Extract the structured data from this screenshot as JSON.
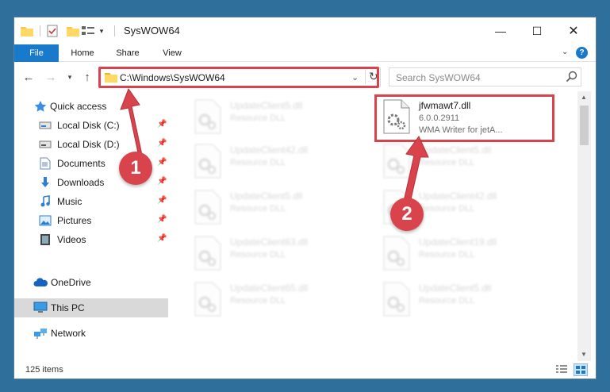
{
  "window": {
    "title": "SysWOW64",
    "min_glyph": "—",
    "max_glyph": "☐",
    "close_glyph": "✕"
  },
  "ribbon": {
    "tabs": [
      {
        "label": "File",
        "active": true
      },
      {
        "label": "Home"
      },
      {
        "label": "Share"
      },
      {
        "label": "View"
      }
    ],
    "help_label": "?"
  },
  "address": {
    "path": "C:\\Windows\\SysWOW64",
    "highlight_color": "#d9434c"
  },
  "search": {
    "placeholder": "Search SysWOW64"
  },
  "sidebar": {
    "items": [
      {
        "label": "Quick access",
        "icon": "star-icon",
        "pinned": false
      },
      {
        "label": "Local Disk (C:)",
        "icon": "drive-icon",
        "pinned": true
      },
      {
        "label": "Local Disk (D:)",
        "icon": "drive-icon",
        "pinned": true
      },
      {
        "label": "Documents",
        "icon": "documents-icon",
        "pinned": true
      },
      {
        "label": "Downloads",
        "icon": "downloads-icon",
        "pinned": true
      },
      {
        "label": "Music",
        "icon": "music-icon",
        "pinned": true
      },
      {
        "label": "Pictures",
        "icon": "pictures-icon",
        "pinned": true
      },
      {
        "label": "Videos",
        "icon": "videos-icon",
        "pinned": true
      },
      {
        "label": "OneDrive",
        "icon": "cloud-icon",
        "pinned": false
      },
      {
        "label": "This PC",
        "icon": "computer-icon",
        "pinned": false,
        "selected": true
      },
      {
        "label": "Network",
        "icon": "network-icon",
        "pinned": false
      }
    ]
  },
  "files": {
    "left_column": [
      {
        "name": "UpdateClient5.dll",
        "desc": "Resource DLL"
      },
      {
        "name": "UpdateClient42.dll",
        "desc": "Resource DLL"
      },
      {
        "name": "UpdateClient5.dll",
        "desc": "Resource DLL"
      },
      {
        "name": "UpdateClient63.dll",
        "desc": "Resource DLL"
      },
      {
        "name": "UpdateClient65.dll",
        "desc": "Resource DLL"
      }
    ],
    "highlighted": {
      "name": "jfwmawt7.dll",
      "version": "6.0.0.2911",
      "desc": "WMA Writer for jetA..."
    },
    "right_column": [
      {
        "name": "UpdateClient5.dll",
        "desc": "Resource DLL"
      },
      {
        "name": "UpdateClient42.dll",
        "desc": "Resource DLL"
      },
      {
        "name": "UpdateClient19.dll",
        "desc": "Resource DLL"
      },
      {
        "name": "UpdateClient5.dll",
        "desc": "Resource DLL"
      }
    ]
  },
  "status": {
    "item_count": "125 items"
  },
  "callouts": [
    {
      "label": "1",
      "color": "#d9434c"
    },
    {
      "label": "2",
      "color": "#d9434c"
    }
  ],
  "colors": {
    "accent": "#1979ca",
    "highlight": "#d9434c",
    "selected_bg": "#d9d9d9"
  }
}
